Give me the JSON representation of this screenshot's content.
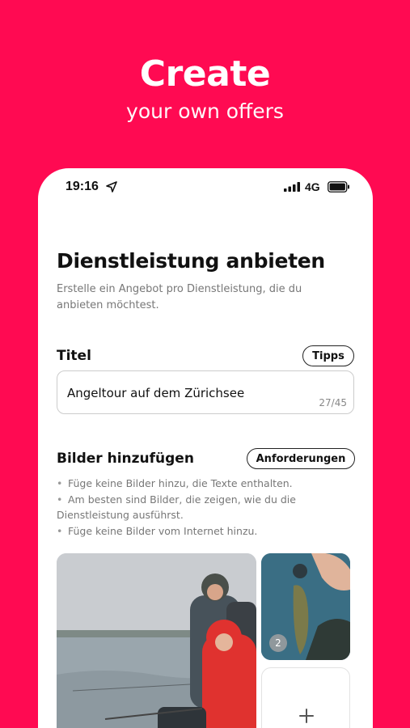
{
  "promo": {
    "headline": "Create",
    "subline": "your own offers"
  },
  "status_bar": {
    "time": "19:16",
    "network": "4G",
    "icons": [
      "location-arrow-icon",
      "signal-bars-icon",
      "battery-icon"
    ]
  },
  "page": {
    "title": "Dienstleistung anbieten",
    "description": "Erstelle ein Angebot pro Dienstleistung, die du anbieten möchtest."
  },
  "title_section": {
    "label": "Titel",
    "tips_button": "Tipps",
    "input_value": "Angeltour auf dem Zürichsee",
    "counter": "27/45"
  },
  "images_section": {
    "label": "Bilder hinzufügen",
    "requirements_button": "Anforderungen",
    "requirements": [
      "Füge keine Bilder hinzu, die Texte enthalten.",
      "Am besten sind Bilder, die zeigen, wie du die Dienstleistung ausführst.",
      "Füge keine Bilder vom Internet hinzu."
    ],
    "photo_badge": "2",
    "add_icon": "plus-icon"
  },
  "colors": {
    "brand": "#ff0a52",
    "text": "#111111",
    "muted": "#777777"
  }
}
